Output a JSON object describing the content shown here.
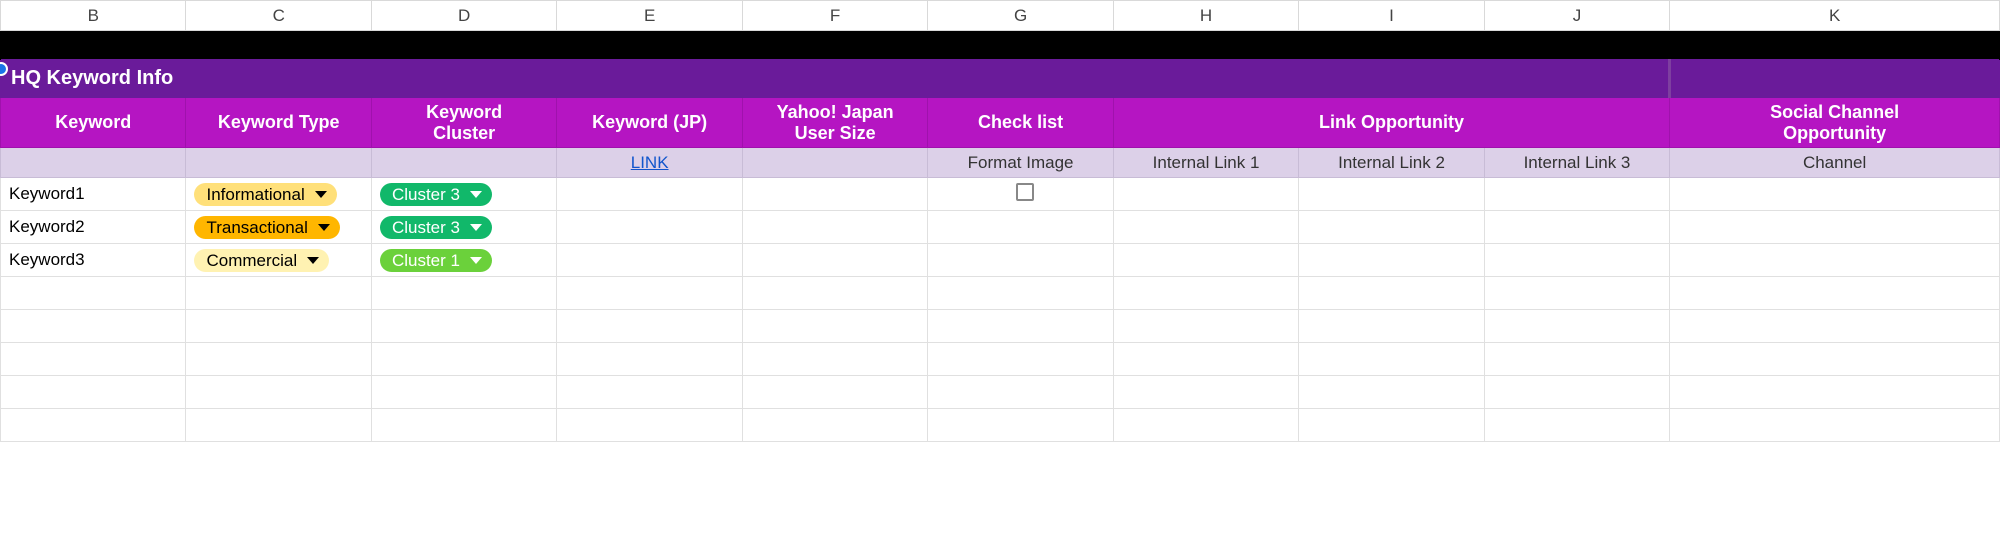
{
  "columns": [
    "B",
    "C",
    "D",
    "E",
    "F",
    "G",
    "H",
    "I",
    "J",
    "K"
  ],
  "section_title": "HQ Keyword Info",
  "headers": {
    "keyword": "Keyword",
    "keyword_type": "Keyword Type",
    "keyword_cluster": "Keyword\nCluster",
    "keyword_jp": "Keyword (JP)",
    "yahoo_user_size": "Yahoo! Japan\nUser Size",
    "checklist": "Check list",
    "link_opportunity": "Link Opportunity",
    "social_channel": "Social Channel\nOpportunity"
  },
  "subheaders": {
    "link_text": "LINK",
    "format_image": "Format Image",
    "internal_link_1": "Internal Link 1",
    "internal_link_2": "Internal Link 2",
    "internal_link_3": "Internal Link 3",
    "channel": "Channel"
  },
  "rows": [
    {
      "keyword": "Keyword1",
      "type": "Informational",
      "type_class": "pill-informational",
      "cluster": "Cluster 3",
      "cluster_class": "pill-cluster3",
      "show_check": true
    },
    {
      "keyword": "Keyword2",
      "type": "Transactional",
      "type_class": "pill-transactional",
      "cluster": "Cluster 3",
      "cluster_class": "pill-cluster3",
      "show_check": false
    },
    {
      "keyword": "Keyword3",
      "type": "Commercial",
      "type_class": "pill-commercial",
      "cluster": "Cluster 1",
      "cluster_class": "pill-cluster1",
      "show_check": false
    }
  ],
  "colors": {
    "title_bg": "#6a1b9a",
    "header_bg": "#b515c2",
    "sub_bg": "#dcd0e8",
    "link": "#1155cc"
  }
}
